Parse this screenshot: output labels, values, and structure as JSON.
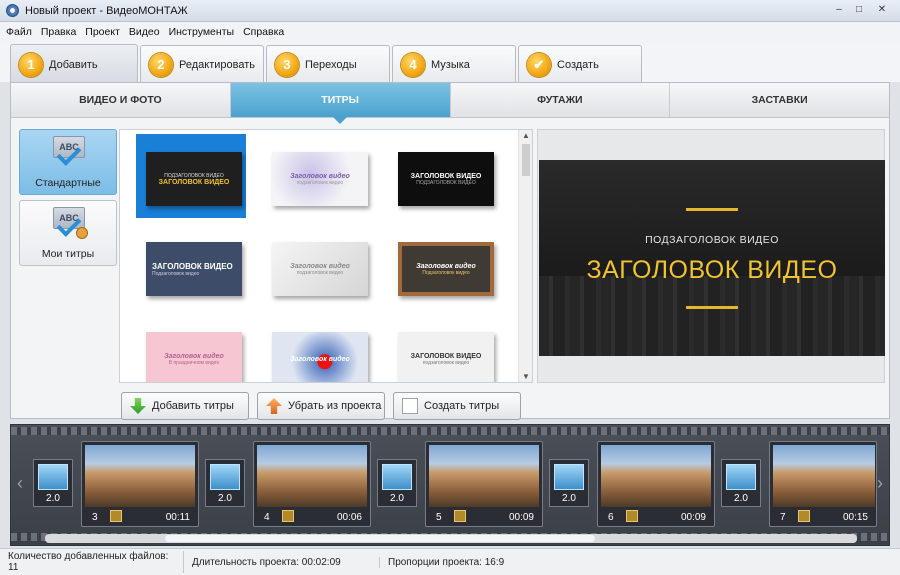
{
  "window": {
    "title": "Новый проект - ВидеоМОНТАЖ",
    "controls": [
      "–",
      "□",
      "✕"
    ]
  },
  "menu": [
    "Файл",
    "Правка",
    "Проект",
    "Видео",
    "Инструменты",
    "Справка"
  ],
  "steps": [
    {
      "num": "1",
      "label": "Добавить"
    },
    {
      "num": "2",
      "label": "Редактировать"
    },
    {
      "num": "3",
      "label": "Переходы"
    },
    {
      "num": "4",
      "label": "Музыка"
    },
    {
      "num": "✔",
      "label": "Создать"
    }
  ],
  "category_tabs": [
    "ВИДЕО И ФОТО",
    "ТИТРЫ",
    "ФУТАЖИ",
    "ЗАСТАВКИ"
  ],
  "title_categories": [
    "Стандартные",
    "Мои титры"
  ],
  "templates": [
    {
      "text": "ЗАГОЛОВОК ВИДЕО",
      "sub": "ПОДЗАГОЛОВОК ВИДЕО",
      "bg": "#1f1f1f",
      "fg": "#f0c330"
    },
    {
      "text": "Заголовок видео",
      "sub": "подзаголовок видео",
      "bg": "#f4f4f7",
      "fg": "#7a5fa8"
    },
    {
      "text": "ЗАГОЛОВОК ВИДЕО",
      "sub": "ПОДЗАГОЛОВОК ВИДЕО",
      "bg": "#0e0e0e",
      "fg": "#ffffff"
    },
    {
      "text": "ЗАГОЛОВОК ВИДЕО",
      "sub": "Подзаголовок видео",
      "bg": "#3d4c68",
      "fg": "#ffffff"
    },
    {
      "text": "Заголовок видео",
      "sub": "подзаголовок видео",
      "bg": "#e6e6e6",
      "fg": "#8a8a8a"
    },
    {
      "text": "Заголовок видео",
      "sub": "Подзаголовок видео",
      "bg": "#3f3a33",
      "fg": "#ffffff"
    },
    {
      "text": "Заголовок видео",
      "sub": "В праздничном видео",
      "bg": "#f6c6d3",
      "fg": "#b8628a"
    },
    {
      "text": "Заголовок видео",
      "sub": "",
      "bg": "#dfe6f2",
      "fg": "#ffffff"
    },
    {
      "text": "ЗАГОЛОВОК ВИДЕО",
      "sub": "подзаголовок видео",
      "bg": "#f1f1f1",
      "fg": "#333333"
    }
  ],
  "buttons": {
    "add": "Добавить титры",
    "remove": "Убрать из проекта",
    "create": "Создать титры"
  },
  "preview": {
    "subtitle": "ПОДЗАГОЛОВОК ВИДЕО",
    "title": "ЗАГОЛОВОК ВИДЕО"
  },
  "timeline": {
    "transitions": [
      "2.0",
      "2.0",
      "2.0",
      "2.0",
      "2.0"
    ],
    "clips": [
      {
        "num": "3",
        "dur": "00:11"
      },
      {
        "num": "4",
        "dur": "00:06"
      },
      {
        "num": "5",
        "dur": "00:09"
      },
      {
        "num": "6",
        "dur": "00:09"
      },
      {
        "num": "7",
        "dur": "00:15"
      }
    ]
  },
  "status": {
    "files": "Количество добавленных файлов: 11",
    "duration": "Длительность проекта:   00:02:09",
    "ratio": "Пропорции проекта:   16:9"
  }
}
